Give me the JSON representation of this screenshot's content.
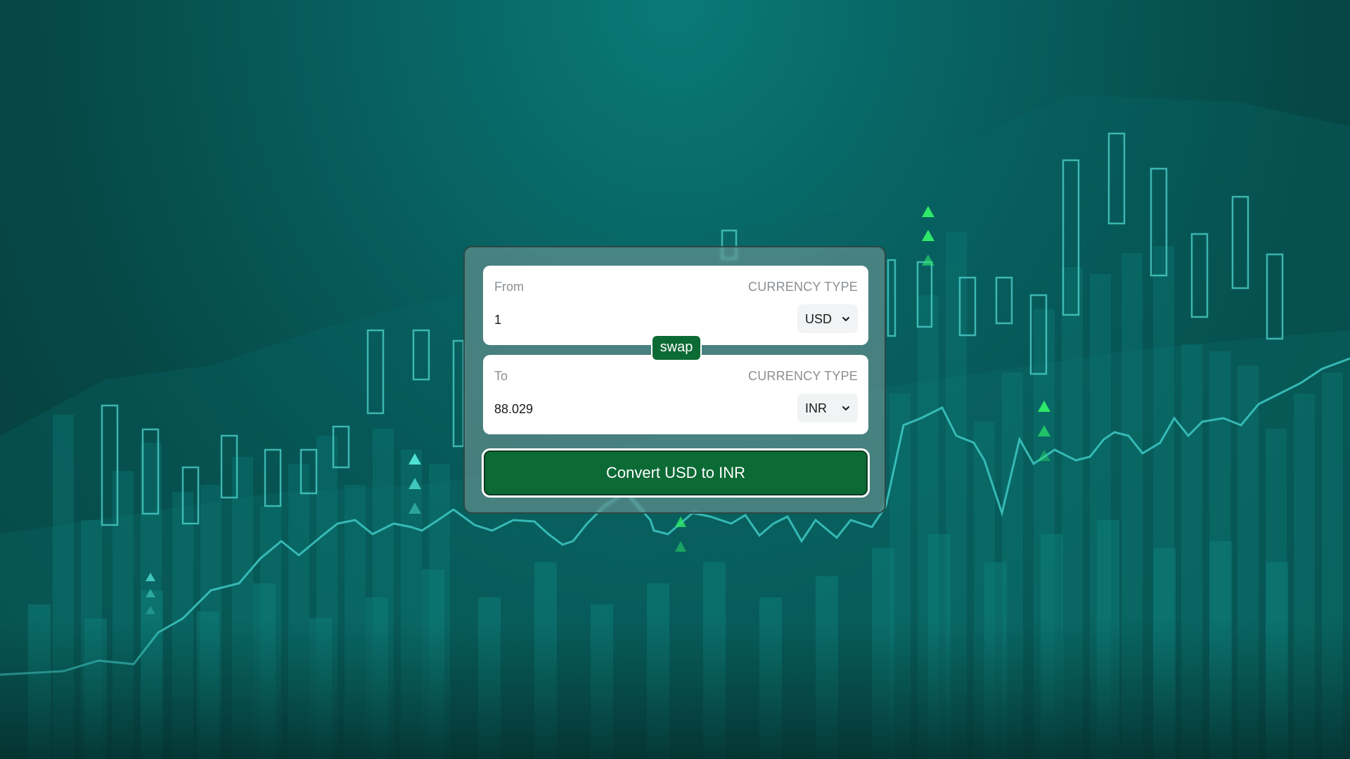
{
  "theme": {
    "accent_green": "#0c6a35",
    "background_teal": "#075e5d",
    "candle_outline": "#4fd6cf",
    "arrow_green": "#2ee86a"
  },
  "converter": {
    "from": {
      "label": "From",
      "currency_type_label": "CURRENCY TYPE",
      "amount": "1",
      "currency": "USD"
    },
    "swap_label": "swap",
    "to": {
      "label": "To",
      "currency_type_label": "CURRENCY TYPE",
      "amount": "88.029",
      "currency": "INR"
    },
    "convert_label": "Convert USD to INR"
  }
}
